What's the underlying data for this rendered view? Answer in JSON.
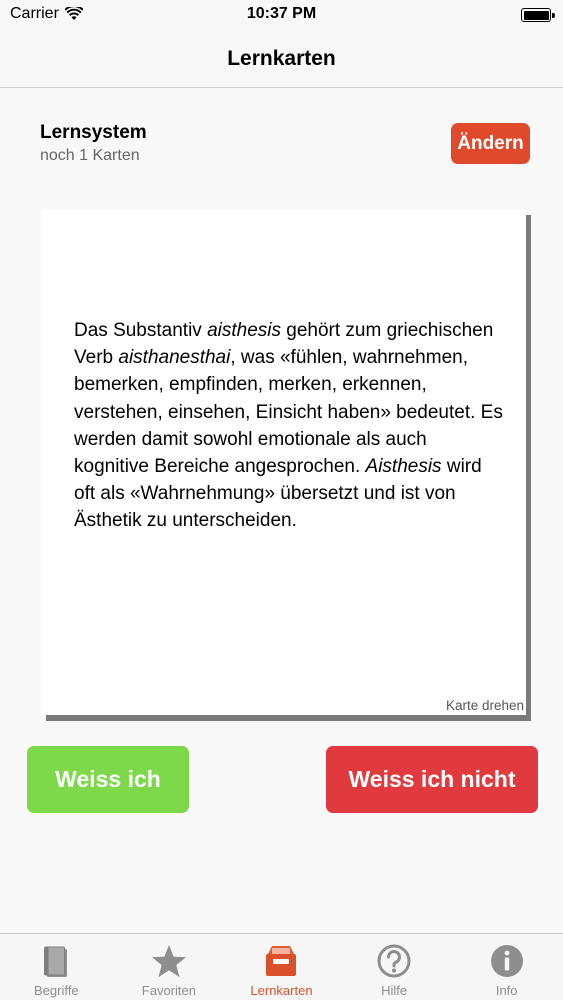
{
  "status_bar": {
    "carrier": "Carrier",
    "time": "10:37 PM",
    "wifi_icon": "wifi-icon",
    "battery_icon": "battery-icon"
  },
  "nav": {
    "title": "Lernkarten"
  },
  "header": {
    "title": "Lernsystem",
    "subtitle": "noch 1 Karten",
    "change_label": "Ändern"
  },
  "card": {
    "segments": [
      {
        "text": "Das Substantiv ",
        "italic": false
      },
      {
        "text": "aisthesis",
        "italic": true
      },
      {
        "text": " gehört zum griechischen Verb ",
        "italic": false
      },
      {
        "text": "aisthanesthai",
        "italic": true
      },
      {
        "text": ", was «fühlen, wahrnehmen, bemerken, empfinden, merken, erkennen, verstehen, einsehen, Einsicht haben» bedeutet. Es werden damit sowohl emotionale als auch kognitive Bereiche angesprochen. ",
        "italic": false
      },
      {
        "text": "Aisthesis",
        "italic": true
      },
      {
        "text": " wird oft als «Wahrnehmung» übersetzt und ist von Ästhetik zu unterscheiden.",
        "italic": false
      }
    ],
    "flip_label": "Karte drehen"
  },
  "actions": {
    "know_label": "Weiss ich",
    "dont_know_label": "Weiss ich nicht"
  },
  "colors": {
    "accent": "#d9502b",
    "change_button": "#e04a2c",
    "know_button": "#7dd94a",
    "dont_know_button": "#e03a3e",
    "tab_inactive": "#8e8e8e"
  },
  "tabs": [
    {
      "label": "Begriffe",
      "icon": "book-icon",
      "active": false
    },
    {
      "label": "Favoriten",
      "icon": "star-icon",
      "active": false
    },
    {
      "label": "Lernkarten",
      "icon": "tray-icon",
      "active": true
    },
    {
      "label": "Hilfe",
      "icon": "question-icon",
      "active": false
    },
    {
      "label": "Info",
      "icon": "info-icon",
      "active": false
    }
  ]
}
